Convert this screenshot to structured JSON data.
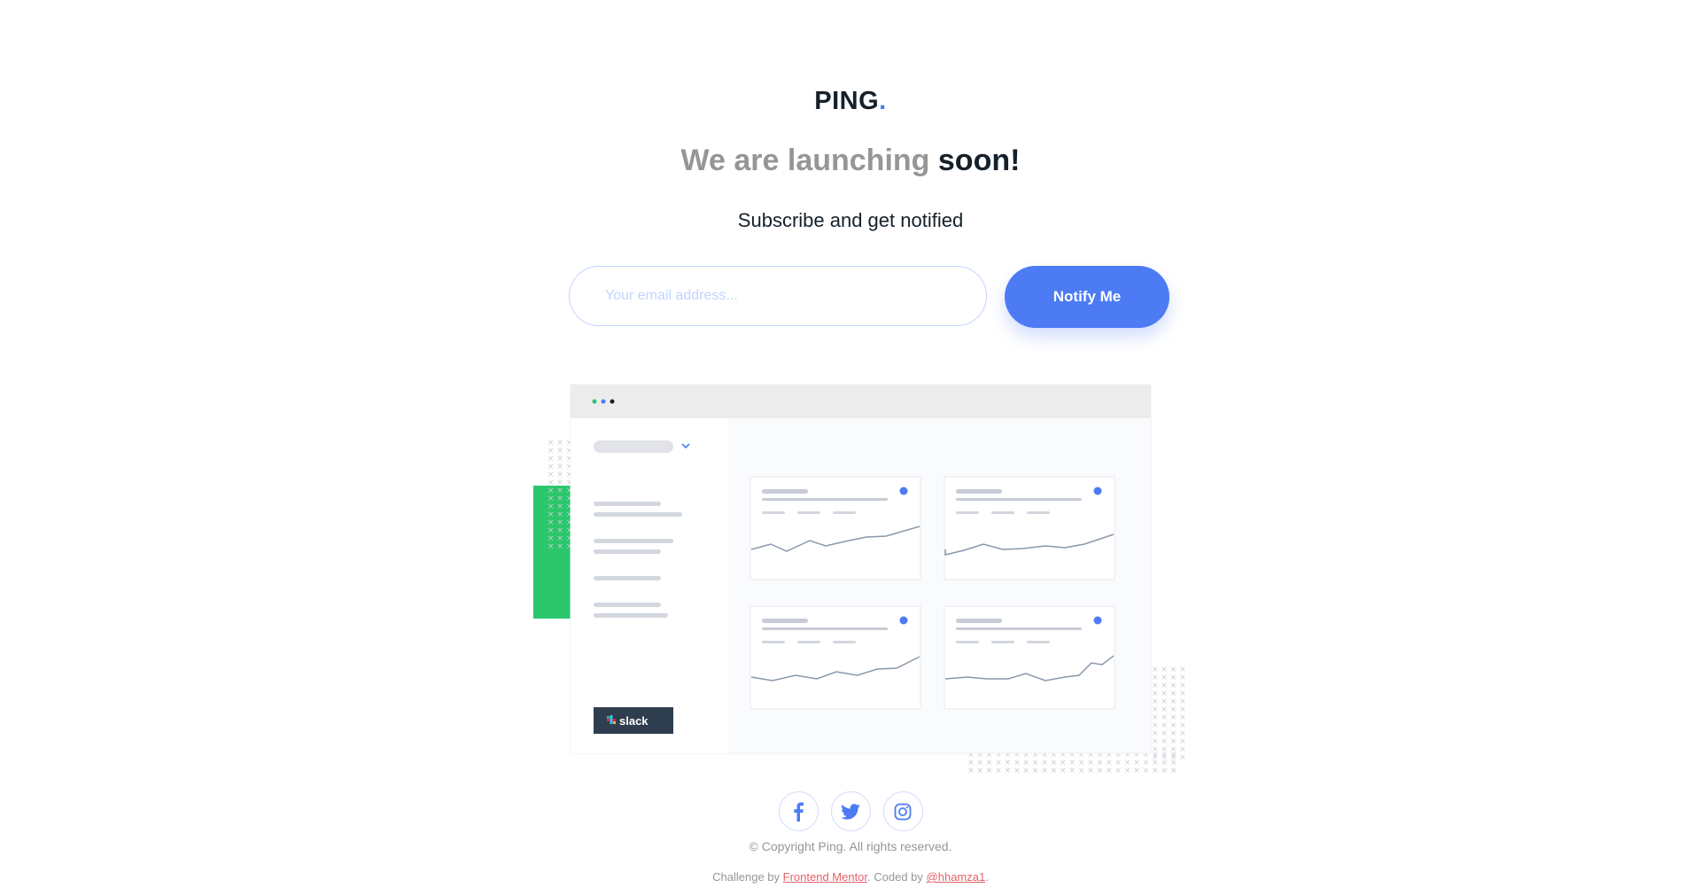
{
  "brand": {
    "name": "PING",
    "dot": "."
  },
  "hero": {
    "headline_light": "We are launching",
    "headline_bold": "soon!",
    "subline": "Subscribe and get notified"
  },
  "form": {
    "email_placeholder": "Your email address...",
    "email_value": "",
    "button_label": "Notify Me"
  },
  "illustration": {
    "badge_label": "slack"
  },
  "socials": [
    {
      "icon": "facebook-icon"
    },
    {
      "icon": "twitter-icon"
    },
    {
      "icon": "instagram-icon"
    }
  ],
  "footer": {
    "copyright": "© Copyright Ping. All rights reserved.",
    "challenge_prefix": "Challenge by ",
    "challenge_link": "Frontend Mentor",
    "coded_prefix": ". Coded by ",
    "coded_link": "@hhamza1",
    "suffix": "."
  },
  "colors": {
    "accent": "#4c7bf3",
    "dark": "#15202a",
    "gray": "#969696",
    "light_blue": "#c2d3ff",
    "link_red": "#e3626a",
    "green": "#2cc76c"
  }
}
